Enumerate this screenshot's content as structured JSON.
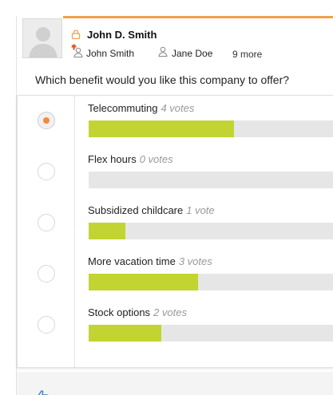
{
  "post": {
    "author": "John D. Smith",
    "recipients": [
      "John Smith",
      "Jane Doe"
    ],
    "more_recipients": "9 more",
    "question": "Which benefit would you like this company to offer?"
  },
  "poll": {
    "options": [
      {
        "label": "Telecommuting",
        "votes": "4 votes",
        "share": 0.59,
        "selected": true
      },
      {
        "label": "Flex hours",
        "votes": "0 votes",
        "share": 0.0,
        "selected": false
      },
      {
        "label": "Subsidized childcare",
        "votes": "1 vote",
        "share": 0.15,
        "selected": false
      },
      {
        "label": "More vacation time",
        "votes": "3 votes",
        "share": 0.445,
        "selected": false
      },
      {
        "label": "Stock options",
        "votes": "2 votes",
        "share": 0.295,
        "selected": false
      }
    ]
  },
  "icons": {
    "avatar": "default-avatar-icon",
    "privacy": "lock-icon",
    "recipient": "person-icon",
    "origin": "flag-icon",
    "like": "thumbs-up-icon"
  },
  "colors": {
    "accent": "#f0a04b",
    "bar_fill": "#c2d431",
    "bar_track": "#e6e6e6",
    "radio_selected": "#f08b3c"
  }
}
